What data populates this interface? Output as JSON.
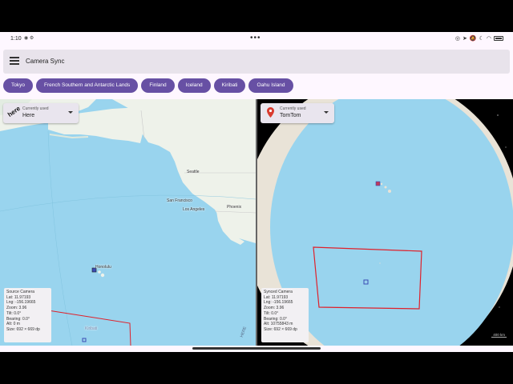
{
  "status_bar": {
    "time": "1:10",
    "left_icons": [
      "notification-icon",
      "settings-icon"
    ],
    "right_icons": [
      "location-icon",
      "navigation-icon",
      "mute-icon",
      "dnd-icon",
      "wifi-icon",
      "battery-icon"
    ]
  },
  "app_bar": {
    "title": "Camera Sync",
    "menu_icon": "hamburger-menu-icon"
  },
  "chips": [
    "Tokyo",
    "French Southern and Antarctic Lands",
    "Finland",
    "Iceland",
    "Kiribati",
    "Oahu Island"
  ],
  "left_map": {
    "provider_caption": "Currently used",
    "provider_value": "Here",
    "logo_text": "here",
    "labels": {
      "seattle": "Seattle",
      "san_francisco": "San Francisco",
      "los_angeles": "Los Angeles",
      "phoenix": "Phoenix",
      "honolulu": "Honolulu",
      "kiribati": "Kiribati"
    },
    "watermark": "HERE",
    "info": {
      "title": "Source Camera",
      "lat": "Lat: 11.97193",
      "lng": "Lng: -156.19665",
      "zoom": "Zoom: 3.96",
      "tilt": "Tilt: 0.0°",
      "bearing": "Bearing: 0.0°",
      "alt": "Alt: 0 m",
      "size": "Size: 692 × 669 dp"
    }
  },
  "right_map": {
    "provider_caption": "Currently used",
    "provider_value": "TomTom",
    "provider_icon": "map-pin-icon",
    "scale": "400 km",
    "info": {
      "title": "Synced Camera",
      "lat": "Lat: 11.97193",
      "lng": "Lng: -156.19665",
      "zoom": "Zoom: 3.96",
      "tilt": "Tilt: 0.0°",
      "bearing": "Bearing: 0.0°",
      "alt": "Alt: 10755843 m",
      "size": "Size: 692 × 669 dp"
    }
  },
  "colors": {
    "chip": "#6750a4",
    "ocean": "#99d4ee",
    "land": "#eef2ea",
    "highlight_rect": "#e0202a",
    "marker": "#3b4bb4"
  }
}
